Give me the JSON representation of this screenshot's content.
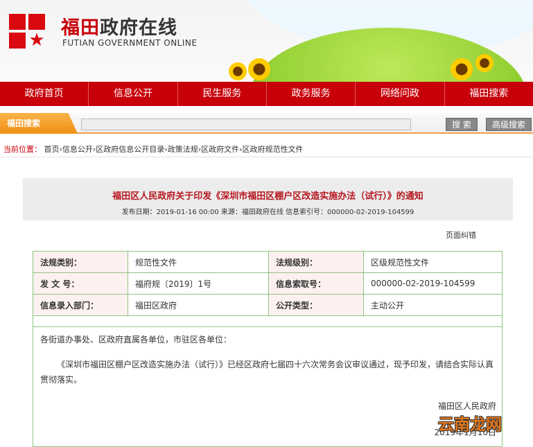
{
  "header": {
    "title_red": "福田",
    "title_dark": "政府在线",
    "subtitle": "FUTIAN GOVERNMENT ONLINE"
  },
  "nav": [
    "政府首页",
    "信息公开",
    "民生服务",
    "政务服务",
    "网络问政",
    "福田搜索"
  ],
  "search": {
    "tab": "福田搜索",
    "value": "",
    "search_button": "搜 索",
    "advanced_button": "高级搜索"
  },
  "breadcrumb": {
    "label": "当前位置：",
    "path": "首页›信息公开›区政府信息公开目录›政策法规›区政府文件›区政府规范性文件"
  },
  "article": {
    "title": "福田区人民政府关于印发《深圳市福田区棚户区改造实施办法（试行）》的通知",
    "meta": "发布日期：2019-01-16 00:00 来源：福田政府在线 信息索引号：000000-02-2019-104599",
    "correction_link": "页面纠错",
    "info_table": [
      [
        "法规类别：",
        "规范性文件",
        "法规级别：",
        "区级规范性文件"
      ],
      [
        "发 文 号：",
        "福府规〔2019〕1号",
        "信息索取号：",
        "000000-02-2019-104599"
      ],
      [
        "信息录入部门：",
        "福田区政府",
        "公开类型：",
        "主动公开"
      ]
    ],
    "salutation": "各街道办事处、区政府直属各单位，市驻区各单位：",
    "paragraph": "《深圳市福田区棚户区改造实施办法（试行）》已经区政府七届四十六次常务会议审议通过，现予印发，请结合实际认真贯彻落实。",
    "signature": "福田区人民政府",
    "date": "2019年1月10日"
  },
  "watermark": "云南龙网",
  "colors": {
    "brand_red": "#c8000a",
    "search_orange": "#f08f12",
    "table_border": "#8fc47e"
  }
}
